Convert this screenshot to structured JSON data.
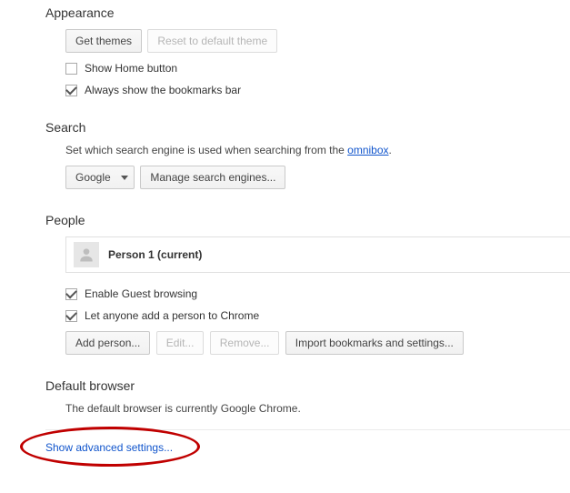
{
  "appearance": {
    "title": "Appearance",
    "get_themes": "Get themes",
    "reset_theme": "Reset to default theme",
    "show_home_label": "Show Home button",
    "show_home_checked": false,
    "bookmarks_label": "Always show the bookmarks bar",
    "bookmarks_checked": true
  },
  "search": {
    "title": "Search",
    "desc_prefix": "Set which search engine is used when searching from the ",
    "desc_link": "omnibox",
    "desc_suffix": ".",
    "engine": "Google",
    "manage": "Manage search engines..."
  },
  "people": {
    "title": "People",
    "person_name": "Person 1 (current)",
    "guest_label": "Enable Guest browsing",
    "guest_checked": true,
    "anyone_label": "Let anyone add a person to Chrome",
    "anyone_checked": true,
    "add": "Add person...",
    "edit": "Edit...",
    "remove": "Remove...",
    "import": "Import bookmarks and settings..."
  },
  "default_browser": {
    "title": "Default browser",
    "desc": "The default browser is currently Google Chrome."
  },
  "advanced_link": "Show advanced settings..."
}
